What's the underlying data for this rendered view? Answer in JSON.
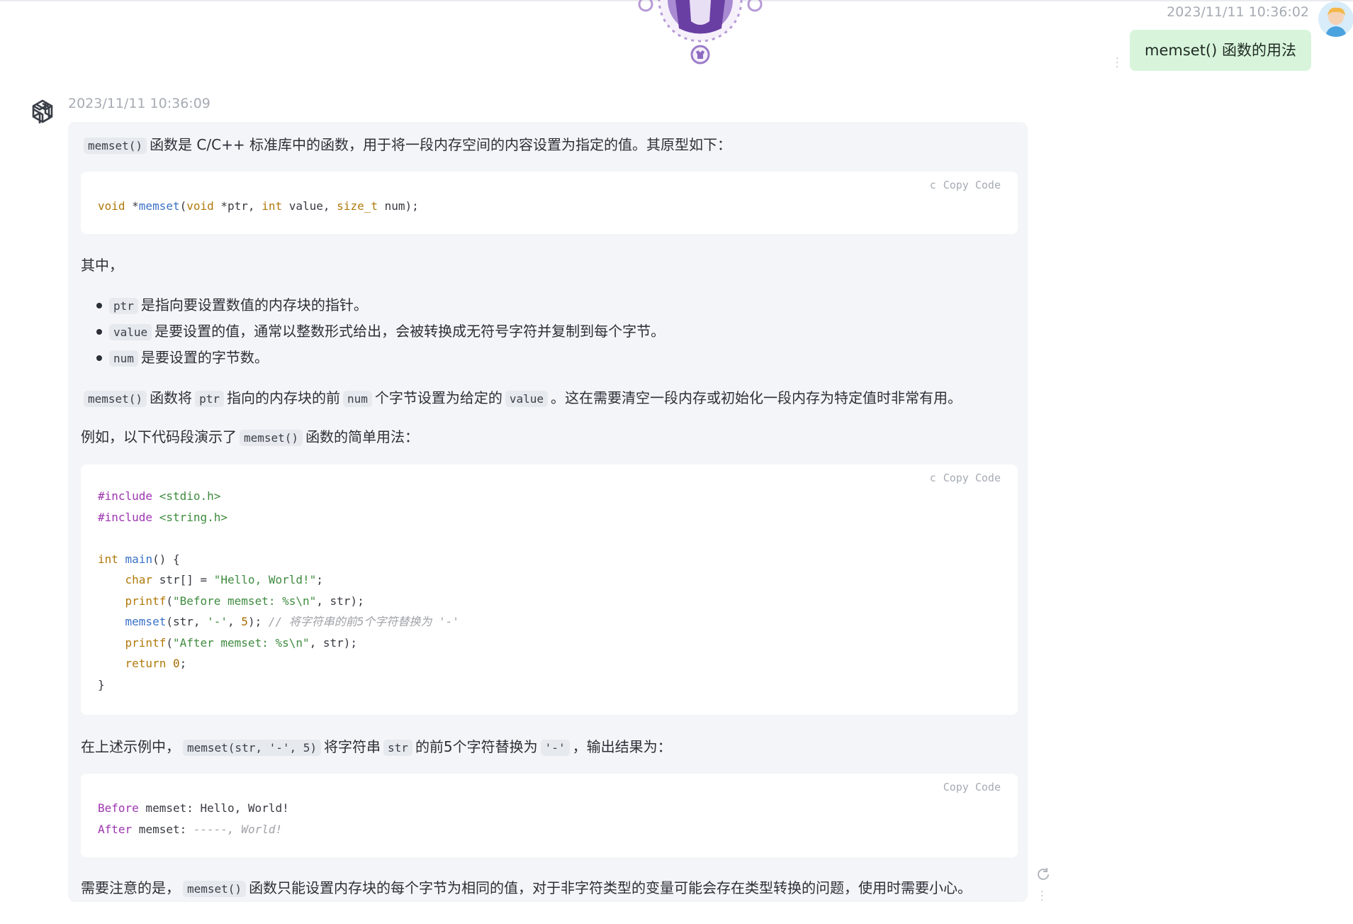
{
  "user_message": {
    "timestamp": "2023/11/11 10:36:02",
    "text": "memset() 函数的用法"
  },
  "assistant_message": {
    "timestamp": "2023/11/11 10:36:09",
    "intro": {
      "code": "memset()",
      "text": "函数是 C/C++ 标准库中的函数，用于将一段内存空间的内容设置为指定的值。其原型如下："
    },
    "code_blocks": [
      {
        "lang": "c",
        "copy_label": "Copy Code"
      },
      {
        "lang": "c",
        "copy_label": "Copy Code"
      },
      {
        "lang": "",
        "copy_label": "Copy Code"
      }
    ],
    "prototype_line": {
      "t1": "void",
      "t2": " *",
      "t3": "memset",
      "t4": "(",
      "t5": "void",
      "t6": " *ptr, ",
      "t7": "int",
      "t8": " value, ",
      "t9": "size_t",
      "t10": " num);"
    },
    "among": "其中，",
    "bullets": [
      {
        "code": "ptr",
        "text": "是指向要设置数值的内存块的指针。"
      },
      {
        "code": "value",
        "text": "是要设置的值，通常以整数形式给出，会被转换成无符号字符并复制到每个字节。"
      },
      {
        "code": "num",
        "text": "是要设置的字节数。"
      }
    ],
    "para_desc": {
      "c1": "memset()",
      "t1": "函数将",
      "c2": "ptr",
      "t2": "指向的内存块的前",
      "c3": "num",
      "t3": "个字节设置为给定的",
      "c4": "value",
      "t4": "。这在需要清空一段内存或初始化一段内存为特定值时非常有用。"
    },
    "para_example": {
      "t1": "例如，以下代码段演示了",
      "c1": "memset()",
      "t2": "函数的简单用法："
    },
    "example_code": {
      "l1a": "#include",
      "l1b": " <stdio.h>",
      "l2a": "#include",
      "l2b": " <string.h>",
      "l4a": "int",
      "l4b": "main",
      "l4c": "() {",
      "l5a": "char",
      "l5b": " str[] = ",
      "l5c": "\"Hello, World!\"",
      "l5d": ";",
      "l6a": "printf",
      "l6b": "(",
      "l6c": "\"Before memset: %s\\n\"",
      "l6d": ", str);",
      "l7a": "memset",
      "l7b": "(str, ",
      "l7c": "'-'",
      "l7d": ", ",
      "l7e": "5",
      "l7f": "); ",
      "l7g": "// 将字符串的前5个字符替换为 '-'",
      "l8a": "printf",
      "l8b": "(",
      "l8c": "\"After memset: %s\\n\"",
      "l8d": ", str);",
      "l9a": "return",
      "l9b": "0",
      "l9c": ";",
      "l10": "}"
    },
    "para_result": {
      "t1": "在上述示例中，",
      "c1": "memset(str, '-', 5)",
      "t2": "将字符串",
      "c2": "str",
      "t3": "的前5个字符替换为",
      "c3": "'-'",
      "t4": "，输出结果为："
    },
    "output_code": {
      "l1a": "Before",
      "l1b": " memset: Hello, World!",
      "l2a": "After",
      "l2b": " memset: ",
      "l2c": "-----, World!"
    },
    "para_note": {
      "t1": "需要注意的是，",
      "c1": "memset()",
      "t2": "函数只能设置内存块的每个字节为相同的值，对于非字符类型的变量可能会存在类型转换的问题，使用时需要小心。"
    }
  }
}
